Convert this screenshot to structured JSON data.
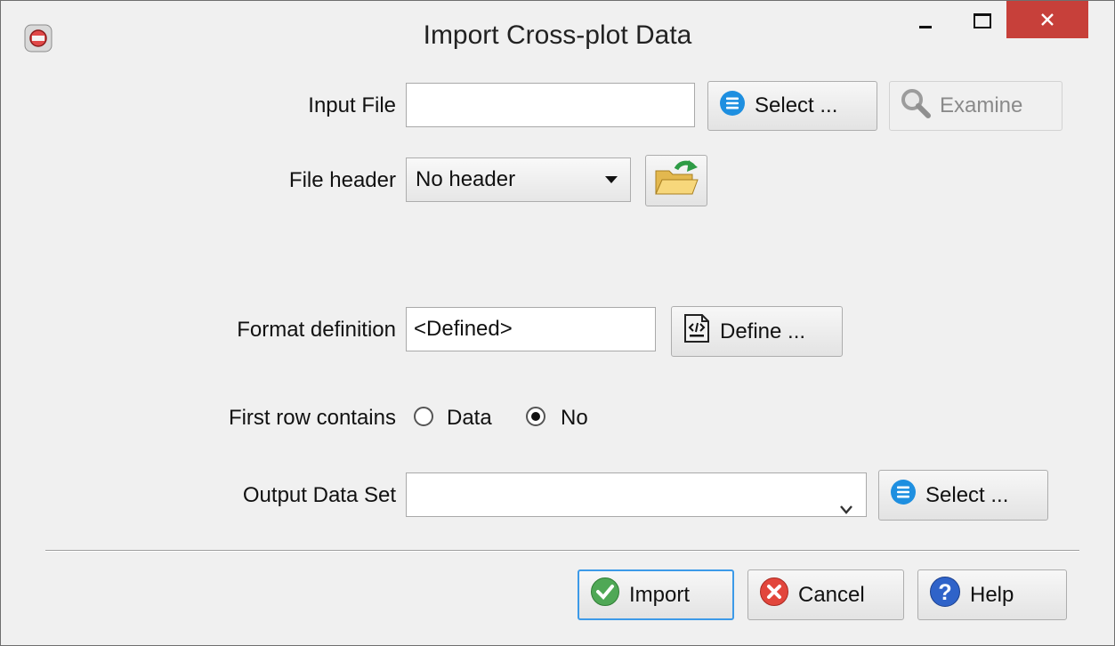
{
  "window": {
    "title": "Import Cross-plot Data",
    "close_color": "#c7403a"
  },
  "form": {
    "input_file": {
      "label": "Input File",
      "value": "",
      "select_label": "Select ...",
      "examine_label": "Examine"
    },
    "file_header": {
      "label": "File header",
      "value": "No header"
    },
    "format_definition": {
      "label": "Format definition",
      "value": "<Defined>",
      "define_label": "Define ..."
    },
    "first_row": {
      "label": "First row contains",
      "options": [
        "Data",
        "No"
      ],
      "selected": "No"
    },
    "output_data_set": {
      "label": "Output Data Set",
      "value": "",
      "select_label": "Select ..."
    }
  },
  "footer": {
    "import_label": "Import",
    "cancel_label": "Cancel",
    "help_label": "Help"
  }
}
